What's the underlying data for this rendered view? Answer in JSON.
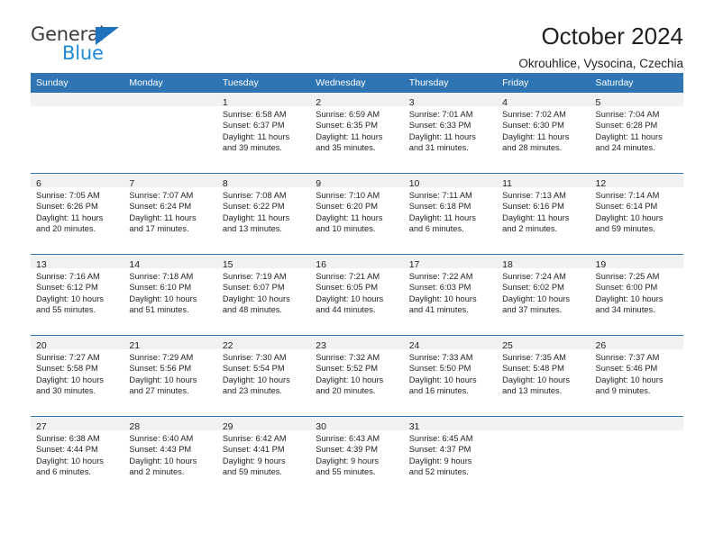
{
  "brand": {
    "name_part1": "General",
    "name_part2": "Blue",
    "triangle_icon": "triangle-logo-icon",
    "colors": {
      "general_text": "#3b3b3b",
      "blue_text": "#1f8ad6",
      "triangle": "#1f72bd"
    }
  },
  "header": {
    "title": "October 2024",
    "subtitle": "Okrouhlice, Vysocina, Czechia"
  },
  "calendar": {
    "accent_color": "#3075b3",
    "daynum_band_color": "#f1f1f1",
    "weekday_headers": [
      "Sunday",
      "Monday",
      "Tuesday",
      "Wednesday",
      "Thursday",
      "Friday",
      "Saturday"
    ],
    "weeks": [
      [
        {
          "day": "",
          "sunrise": "",
          "sunset": "",
          "daylight_line1": "",
          "daylight_line2": ""
        },
        {
          "day": "",
          "sunrise": "",
          "sunset": "",
          "daylight_line1": "",
          "daylight_line2": ""
        },
        {
          "day": "1",
          "sunrise": "Sunrise: 6:58 AM",
          "sunset": "Sunset: 6:37 PM",
          "daylight_line1": "Daylight: 11 hours",
          "daylight_line2": "and 39 minutes."
        },
        {
          "day": "2",
          "sunrise": "Sunrise: 6:59 AM",
          "sunset": "Sunset: 6:35 PM",
          "daylight_line1": "Daylight: 11 hours",
          "daylight_line2": "and 35 minutes."
        },
        {
          "day": "3",
          "sunrise": "Sunrise: 7:01 AM",
          "sunset": "Sunset: 6:33 PM",
          "daylight_line1": "Daylight: 11 hours",
          "daylight_line2": "and 31 minutes."
        },
        {
          "day": "4",
          "sunrise": "Sunrise: 7:02 AM",
          "sunset": "Sunset: 6:30 PM",
          "daylight_line1": "Daylight: 11 hours",
          "daylight_line2": "and 28 minutes."
        },
        {
          "day": "5",
          "sunrise": "Sunrise: 7:04 AM",
          "sunset": "Sunset: 6:28 PM",
          "daylight_line1": "Daylight: 11 hours",
          "daylight_line2": "and 24 minutes."
        }
      ],
      [
        {
          "day": "6",
          "sunrise": "Sunrise: 7:05 AM",
          "sunset": "Sunset: 6:26 PM",
          "daylight_line1": "Daylight: 11 hours",
          "daylight_line2": "and 20 minutes."
        },
        {
          "day": "7",
          "sunrise": "Sunrise: 7:07 AM",
          "sunset": "Sunset: 6:24 PM",
          "daylight_line1": "Daylight: 11 hours",
          "daylight_line2": "and 17 minutes."
        },
        {
          "day": "8",
          "sunrise": "Sunrise: 7:08 AM",
          "sunset": "Sunset: 6:22 PM",
          "daylight_line1": "Daylight: 11 hours",
          "daylight_line2": "and 13 minutes."
        },
        {
          "day": "9",
          "sunrise": "Sunrise: 7:10 AM",
          "sunset": "Sunset: 6:20 PM",
          "daylight_line1": "Daylight: 11 hours",
          "daylight_line2": "and 10 minutes."
        },
        {
          "day": "10",
          "sunrise": "Sunrise: 7:11 AM",
          "sunset": "Sunset: 6:18 PM",
          "daylight_line1": "Daylight: 11 hours",
          "daylight_line2": "and 6 minutes."
        },
        {
          "day": "11",
          "sunrise": "Sunrise: 7:13 AM",
          "sunset": "Sunset: 6:16 PM",
          "daylight_line1": "Daylight: 11 hours",
          "daylight_line2": "and 2 minutes."
        },
        {
          "day": "12",
          "sunrise": "Sunrise: 7:14 AM",
          "sunset": "Sunset: 6:14 PM",
          "daylight_line1": "Daylight: 10 hours",
          "daylight_line2": "and 59 minutes."
        }
      ],
      [
        {
          "day": "13",
          "sunrise": "Sunrise: 7:16 AM",
          "sunset": "Sunset: 6:12 PM",
          "daylight_line1": "Daylight: 10 hours",
          "daylight_line2": "and 55 minutes."
        },
        {
          "day": "14",
          "sunrise": "Sunrise: 7:18 AM",
          "sunset": "Sunset: 6:10 PM",
          "daylight_line1": "Daylight: 10 hours",
          "daylight_line2": "and 51 minutes."
        },
        {
          "day": "15",
          "sunrise": "Sunrise: 7:19 AM",
          "sunset": "Sunset: 6:07 PM",
          "daylight_line1": "Daylight: 10 hours",
          "daylight_line2": "and 48 minutes."
        },
        {
          "day": "16",
          "sunrise": "Sunrise: 7:21 AM",
          "sunset": "Sunset: 6:05 PM",
          "daylight_line1": "Daylight: 10 hours",
          "daylight_line2": "and 44 minutes."
        },
        {
          "day": "17",
          "sunrise": "Sunrise: 7:22 AM",
          "sunset": "Sunset: 6:03 PM",
          "daylight_line1": "Daylight: 10 hours",
          "daylight_line2": "and 41 minutes."
        },
        {
          "day": "18",
          "sunrise": "Sunrise: 7:24 AM",
          "sunset": "Sunset: 6:02 PM",
          "daylight_line1": "Daylight: 10 hours",
          "daylight_line2": "and 37 minutes."
        },
        {
          "day": "19",
          "sunrise": "Sunrise: 7:25 AM",
          "sunset": "Sunset: 6:00 PM",
          "daylight_line1": "Daylight: 10 hours",
          "daylight_line2": "and 34 minutes."
        }
      ],
      [
        {
          "day": "20",
          "sunrise": "Sunrise: 7:27 AM",
          "sunset": "Sunset: 5:58 PM",
          "daylight_line1": "Daylight: 10 hours",
          "daylight_line2": "and 30 minutes."
        },
        {
          "day": "21",
          "sunrise": "Sunrise: 7:29 AM",
          "sunset": "Sunset: 5:56 PM",
          "daylight_line1": "Daylight: 10 hours",
          "daylight_line2": "and 27 minutes."
        },
        {
          "day": "22",
          "sunrise": "Sunrise: 7:30 AM",
          "sunset": "Sunset: 5:54 PM",
          "daylight_line1": "Daylight: 10 hours",
          "daylight_line2": "and 23 minutes."
        },
        {
          "day": "23",
          "sunrise": "Sunrise: 7:32 AM",
          "sunset": "Sunset: 5:52 PM",
          "daylight_line1": "Daylight: 10 hours",
          "daylight_line2": "and 20 minutes."
        },
        {
          "day": "24",
          "sunrise": "Sunrise: 7:33 AM",
          "sunset": "Sunset: 5:50 PM",
          "daylight_line1": "Daylight: 10 hours",
          "daylight_line2": "and 16 minutes."
        },
        {
          "day": "25",
          "sunrise": "Sunrise: 7:35 AM",
          "sunset": "Sunset: 5:48 PM",
          "daylight_line1": "Daylight: 10 hours",
          "daylight_line2": "and 13 minutes."
        },
        {
          "day": "26",
          "sunrise": "Sunrise: 7:37 AM",
          "sunset": "Sunset: 5:46 PM",
          "daylight_line1": "Daylight: 10 hours",
          "daylight_line2": "and 9 minutes."
        }
      ],
      [
        {
          "day": "27",
          "sunrise": "Sunrise: 6:38 AM",
          "sunset": "Sunset: 4:44 PM",
          "daylight_line1": "Daylight: 10 hours",
          "daylight_line2": "and 6 minutes."
        },
        {
          "day": "28",
          "sunrise": "Sunrise: 6:40 AM",
          "sunset": "Sunset: 4:43 PM",
          "daylight_line1": "Daylight: 10 hours",
          "daylight_line2": "and 2 minutes."
        },
        {
          "day": "29",
          "sunrise": "Sunrise: 6:42 AM",
          "sunset": "Sunset: 4:41 PM",
          "daylight_line1": "Daylight: 9 hours",
          "daylight_line2": "and 59 minutes."
        },
        {
          "day": "30",
          "sunrise": "Sunrise: 6:43 AM",
          "sunset": "Sunset: 4:39 PM",
          "daylight_line1": "Daylight: 9 hours",
          "daylight_line2": "and 55 minutes."
        },
        {
          "day": "31",
          "sunrise": "Sunrise: 6:45 AM",
          "sunset": "Sunset: 4:37 PM",
          "daylight_line1": "Daylight: 9 hours",
          "daylight_line2": "and 52 minutes."
        },
        {
          "day": "",
          "sunrise": "",
          "sunset": "",
          "daylight_line1": "",
          "daylight_line2": ""
        },
        {
          "day": "",
          "sunrise": "",
          "sunset": "",
          "daylight_line1": "",
          "daylight_line2": ""
        }
      ]
    ]
  }
}
